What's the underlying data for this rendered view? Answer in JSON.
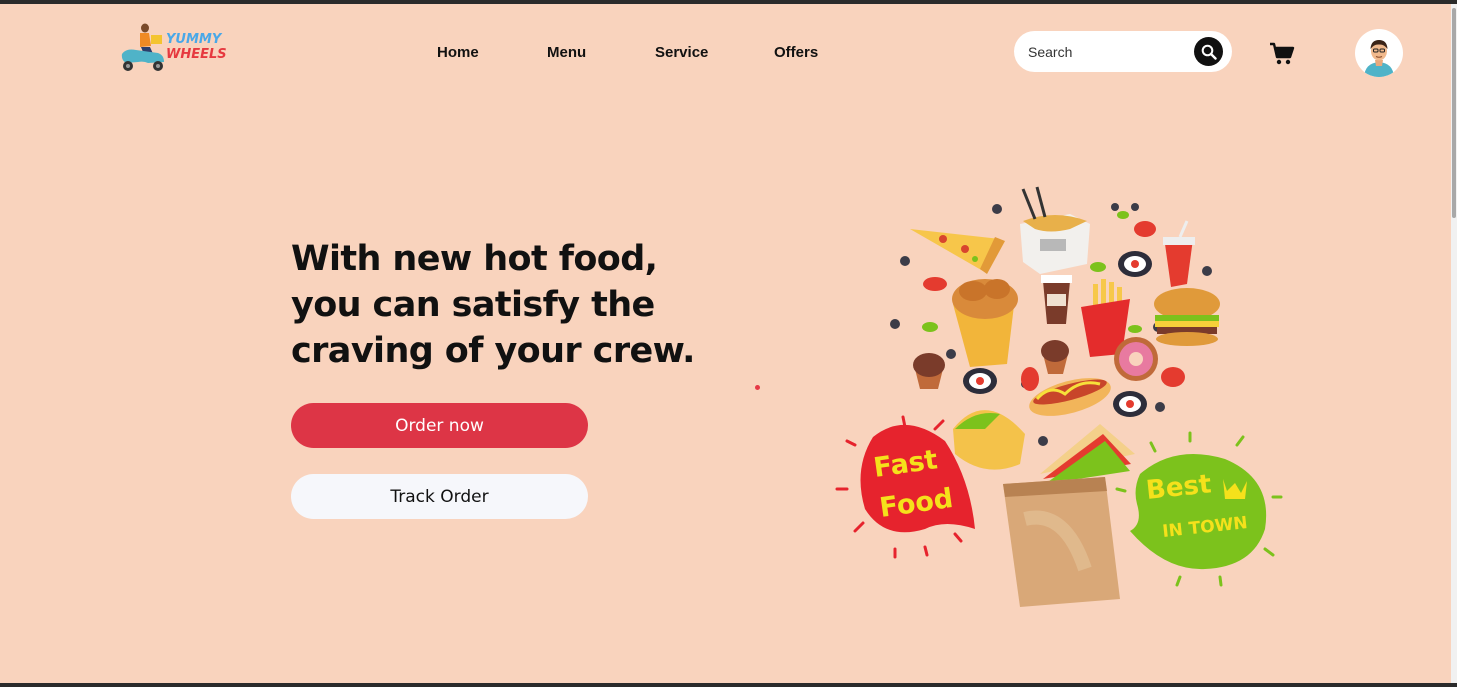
{
  "brand": {
    "line1": "YUMMY",
    "line2": "WHEELS"
  },
  "nav": {
    "home": "Home",
    "menu": "Menu",
    "service": "Service",
    "offers": "Offers"
  },
  "search": {
    "placeholder": "Search",
    "value": ""
  },
  "hero": {
    "headline": "With new hot food, you can satisfy the craving of your crew.",
    "order_button": "Order now",
    "track_button": "Track Order"
  },
  "illustration": {
    "badge_left_line1": "Fast",
    "badge_left_line2": "Food",
    "badge_right_line1": "Best",
    "badge_right_line2": "IN TOWN"
  },
  "colors": {
    "background": "#f9d3bd",
    "primary_button": "#dd3546",
    "secondary_button": "#f6f7fb",
    "badge_red": "#e6232d",
    "badge_green": "#7cc21c",
    "badge_text": "#f5e11b"
  },
  "icons": [
    "scooter-logo-icon",
    "search-icon",
    "cart-icon",
    "user-avatar-icon"
  ]
}
